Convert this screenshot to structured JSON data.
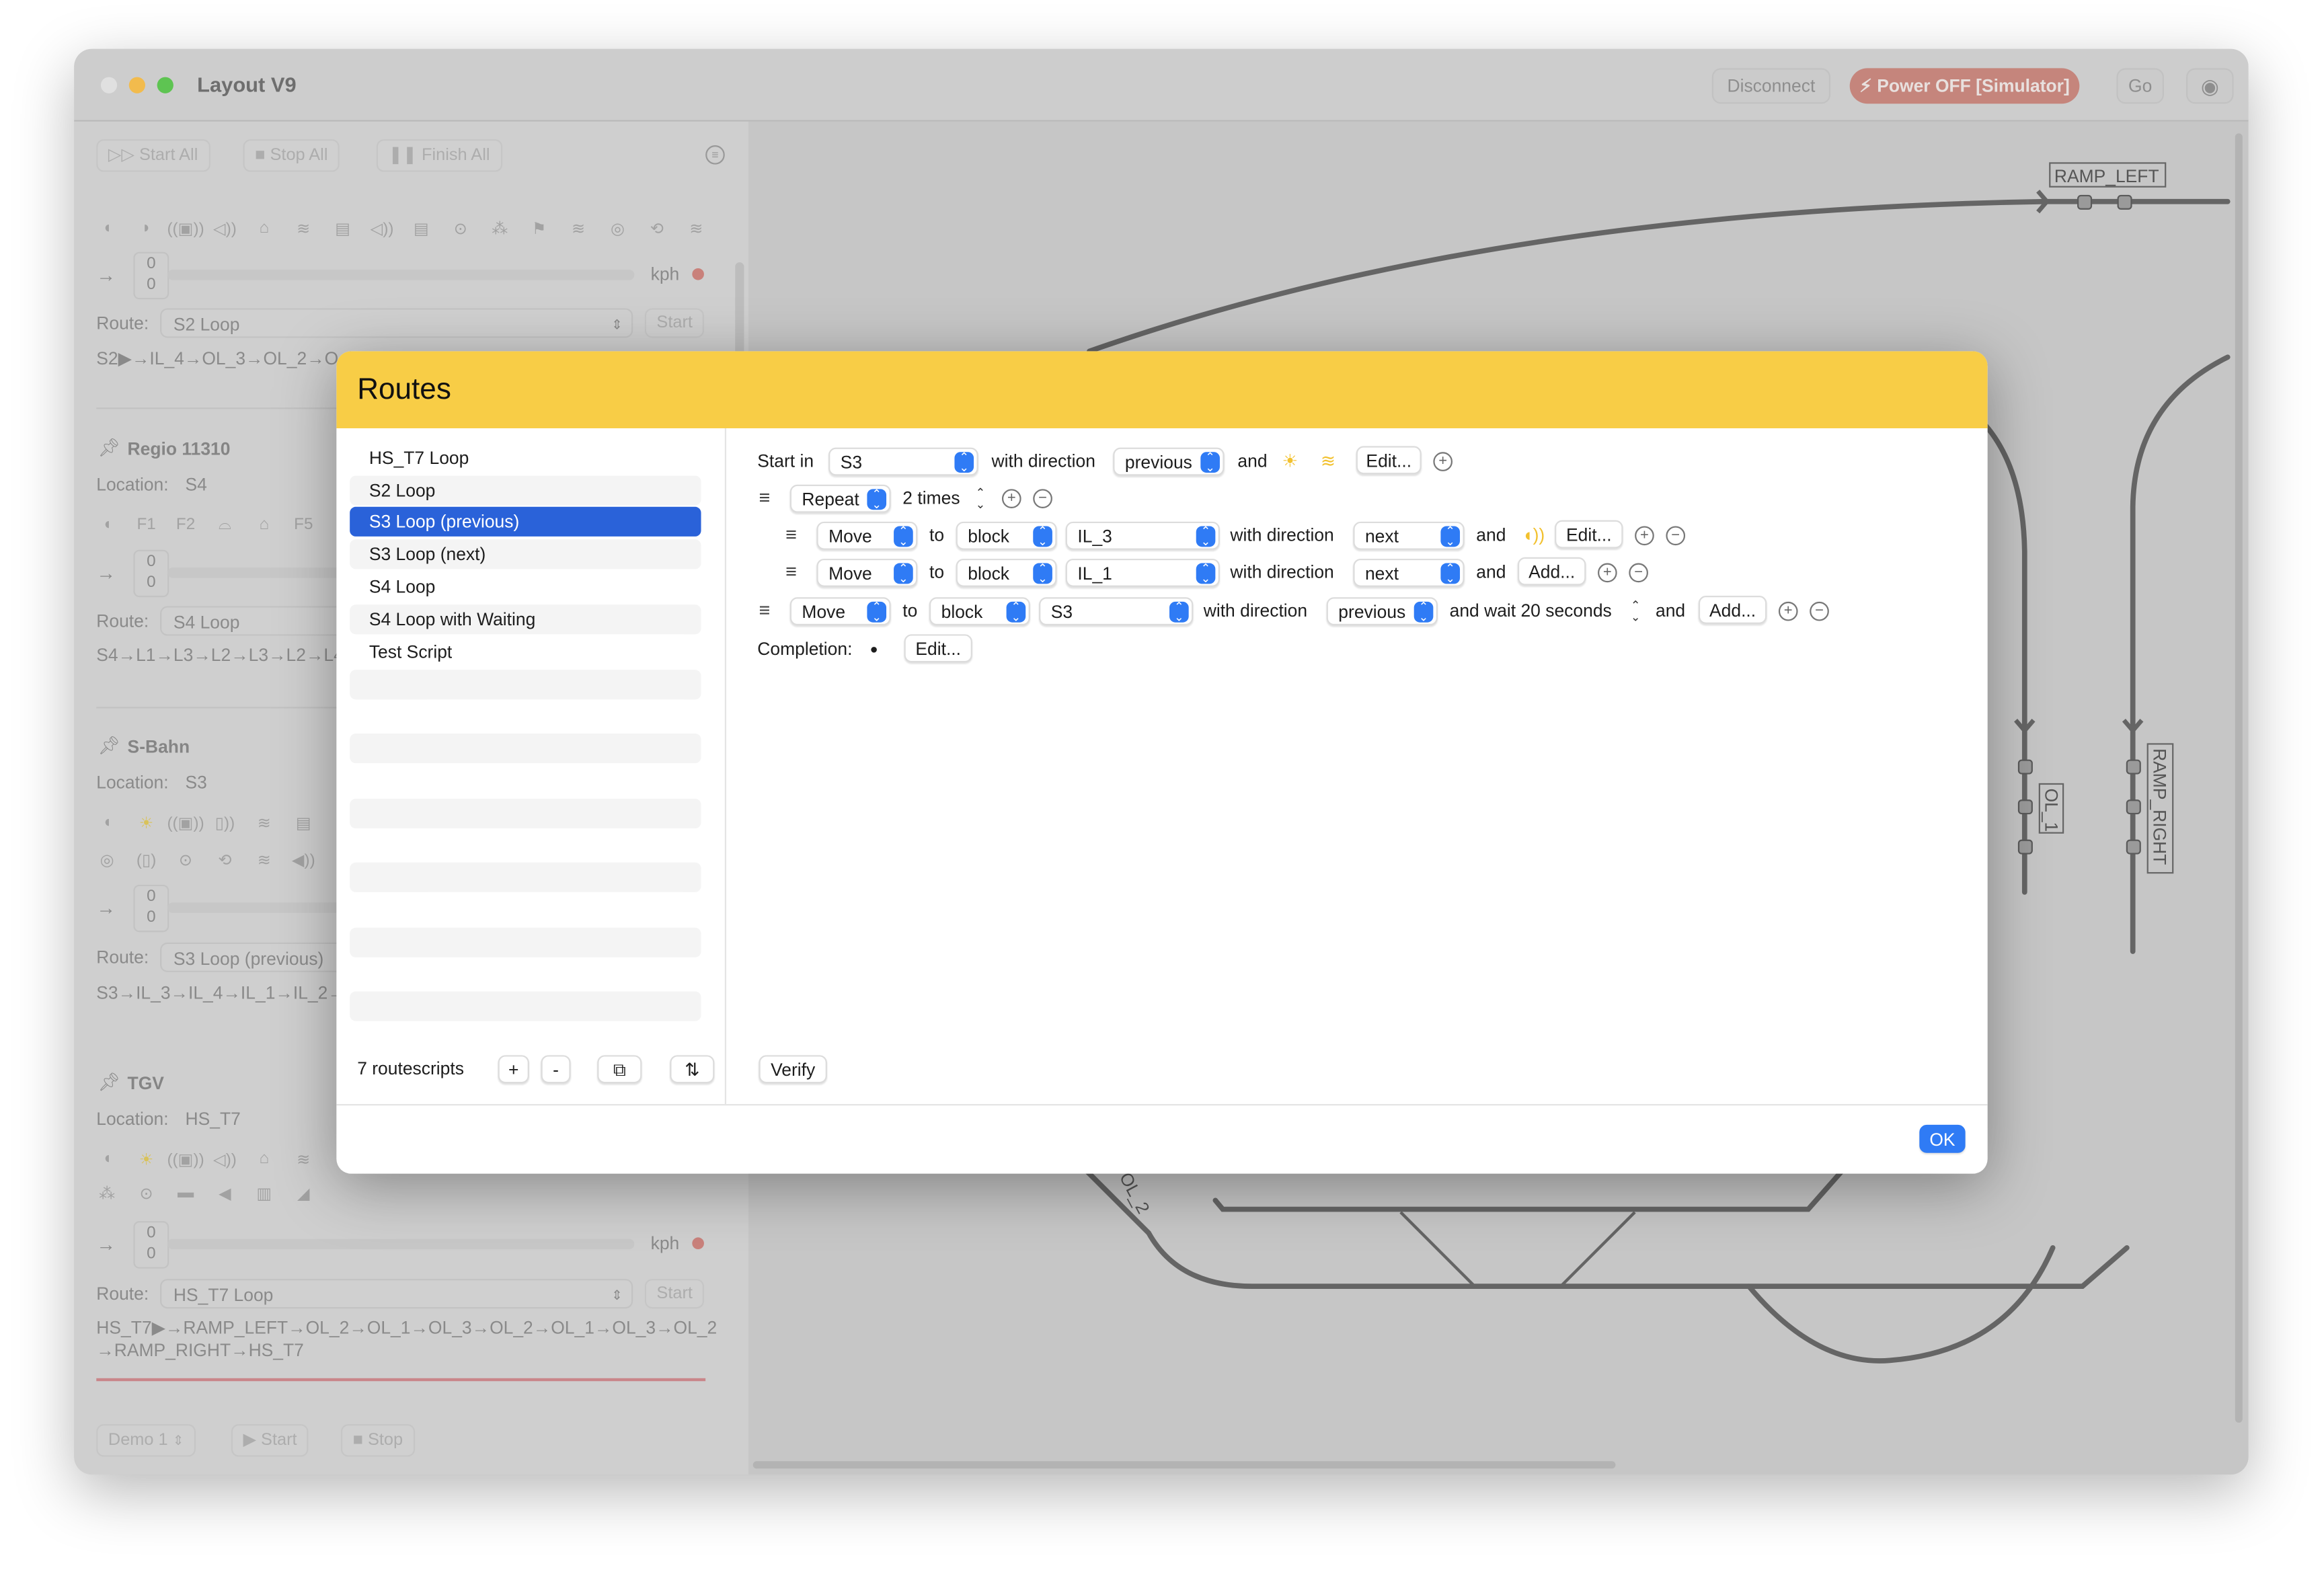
{
  "window": {
    "title": "Layout V9"
  },
  "toolbar": {
    "disconnect": "Disconnect",
    "power": "Power OFF [Simulator]",
    "go": "Go",
    "power_color": "#c5857c"
  },
  "left_toolbar": {
    "start_all": "Start All",
    "stop_all": "Stop All",
    "finish_all": "Finish All"
  },
  "trains": [
    {
      "name": "",
      "location": "",
      "icons": [
        "light",
        "light-half",
        "sound-train",
        "horn",
        "weight",
        "signal",
        "engine",
        "horn",
        "engine",
        "station",
        "steam",
        "flag",
        "signal",
        "wheel",
        "coupler",
        "signal"
      ],
      "speed_top": "0",
      "speed_bottom": "0",
      "unit": "kph",
      "route_label": "Route:",
      "route": "S2 Loop",
      "start": "Start",
      "path": "S2▶→IL_4→OL_3→OL_2→O"
    },
    {
      "name": "Regio 11310",
      "location_label": "Location:",
      "location": "S4",
      "icons": [
        "light",
        "F1",
        "F2",
        "turtle",
        "weight",
        "F5"
      ],
      "speed_top": "0",
      "speed_bottom": "0",
      "route_label": "Route:",
      "route": "S4 Loop",
      "path": "S4→L1→L3→L2→L3→L2→L4"
    },
    {
      "name": "S-Bahn",
      "location_label": "Location:",
      "location": "S3",
      "icons": [
        "light",
        "headlight",
        "sound-train",
        "door",
        "signal",
        "engine",
        "wheel",
        "door-sound",
        "station",
        "coupler",
        "signal",
        "speaker"
      ],
      "speed_top": "0",
      "speed_bottom": "0",
      "route_label": "Route:",
      "route": "S3 Loop (previous)",
      "path": "S3→IL_3→IL_4→IL_1→IL_2→I"
    },
    {
      "name": "TGV",
      "location_label": "Location:",
      "location": "HS_T7",
      "icons": [
        "light",
        "headlight",
        "sound-train",
        "horn",
        "weight",
        "signal",
        "steam",
        "station",
        "train-sound",
        "lock-sound",
        "rail",
        "conductor"
      ],
      "speed_top": "0",
      "speed_bottom": "0",
      "unit": "kph",
      "route_label": "Route:",
      "route": "HS_T7 Loop",
      "start": "Start",
      "path": "HS_T7▶→RAMP_LEFT→OL_2→OL_1→OL_3→OL_2→OL_1→OL_3→OL_2",
      "path2": "→RAMP_RIGHT→HS_T7"
    }
  ],
  "left_bottom": {
    "demo": "Demo 1",
    "start": "Start",
    "stop": "Stop"
  },
  "track_labels": {
    "ramp_left": "RAMP_LEFT",
    "ramp_right": "RAMP_RIGHT",
    "ol_1": "OL_1",
    "ol_2": "OL_2"
  },
  "modal": {
    "title": "Routes",
    "header_color": "#f8cd46",
    "routes": [
      "HS_T7 Loop",
      "S2 Loop",
      "S3 Loop (previous)",
      "S3 Loop (next)",
      "S4 Loop",
      "S4 Loop with Waiting",
      "Test Script"
    ],
    "selected_index": 2,
    "count": "7 routescripts",
    "add": "+",
    "remove": "-",
    "verify": "Verify",
    "ok": "OK",
    "script": {
      "start_in": "Start in",
      "start_block": "S3",
      "with_direction": "with direction",
      "start_direction": "previous",
      "and": "and",
      "edit": "Edit...",
      "repeat": "Repeat",
      "times": "2 times",
      "step1": {
        "action": "Move",
        "to": "to",
        "type": "block",
        "block": "IL_3",
        "direction": "next",
        "button": "Edit..."
      },
      "step2": {
        "action": "Move",
        "to": "to",
        "type": "block",
        "block": "IL_1",
        "direction": "next",
        "button": "Add..."
      },
      "step3": {
        "action": "Move",
        "to": "to",
        "type": "block",
        "block": "S3",
        "direction": "previous",
        "wait": "and wait 20 seconds",
        "button": "Add..."
      },
      "completion": "Completion:",
      "completion_edit": "Edit..."
    }
  }
}
